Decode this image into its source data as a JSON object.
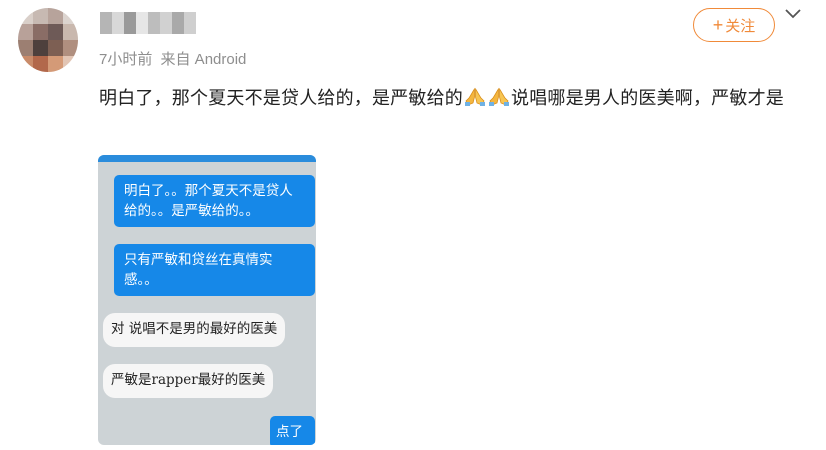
{
  "post": {
    "meta": {
      "time": "7小时前",
      "source": "来自 Android"
    },
    "follow_label": "关注",
    "text_part1": "明白了，那个夏天不是贷人给的，是严敏给的",
    "text_part2": "说唱哪是男人的医美啊，严敏才是",
    "emoji": "folded-hands"
  },
  "screenshot": {
    "messages": [
      {
        "side": "sent",
        "text": "明白了。。那个夏天不是贷人给的。。是严敏给的。。"
      },
      {
        "side": "sent",
        "text": "只有严敏和贷丝在真情实感。。"
      },
      {
        "side": "received",
        "text": "对 说唱不是男的最好的医美"
      },
      {
        "side": "received",
        "text": "严敏是rapper最好的医美"
      },
      {
        "side": "sent",
        "text": "点了"
      }
    ]
  },
  "colors": {
    "accent": "#f08a39",
    "bubble_blue": "#1688e8",
    "screenshot_bg": "#cdd3d6"
  }
}
